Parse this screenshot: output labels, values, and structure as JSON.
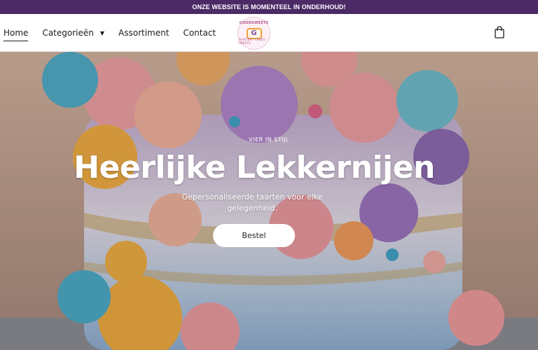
{
  "announcement": {
    "text": "ONZE WEBSITE IS MOMENTEEL IN ONDERHOUD!"
  },
  "nav": {
    "items": [
      {
        "label": "Home",
        "active": true
      },
      {
        "label": "Categorieën",
        "has_dropdown": true
      },
      {
        "label": "Assortiment"
      },
      {
        "label": "Contact"
      }
    ]
  },
  "logo": {
    "ring_text": "GOODSWEETS",
    "monogram": "G",
    "ring_bottom": "TAARTEN · CAKES · SWEETS"
  },
  "icons": {
    "cart": "shopping-bag-icon",
    "dropdown": "chevron-down-icon"
  },
  "hero": {
    "eyebrow": "VIER IN STIJL",
    "title": "Heerlijke Lekkernijen",
    "subtitle": "Gepersonaliseerde taarten voor elke gelegenheid.",
    "cta": "Bestel"
  },
  "colors": {
    "announcement_bg": "#4b2a66",
    "text": "#1c1c1c",
    "cta_bg": "#ffffff"
  }
}
